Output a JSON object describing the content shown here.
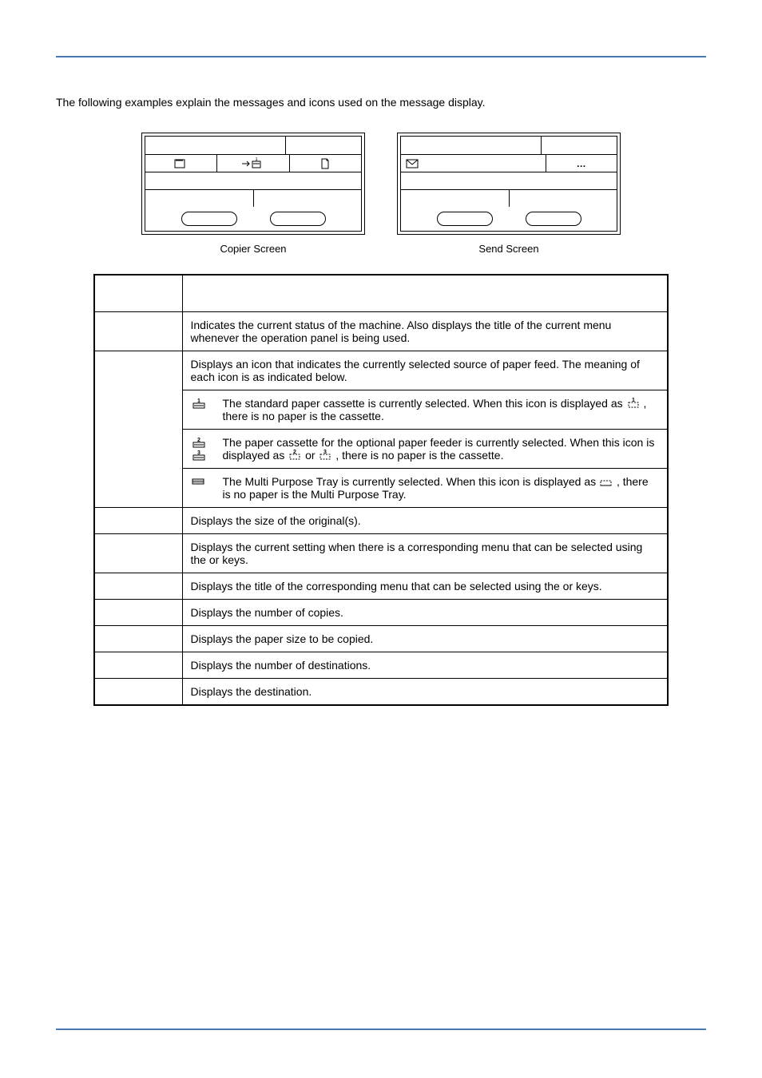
{
  "intro": "The following examples explain the messages and icons used on the message display.",
  "screens": {
    "left_caption": "Copier Screen",
    "right_caption": "Send Screen"
  },
  "table": {
    "header_left": "",
    "header_right": "",
    "rows": [
      {
        "ref": "",
        "desc": "Indicates the current status of the machine. Also displays the title of the current menu whenever the operation panel is being used."
      },
      {
        "ref": "",
        "desc": "Displays an icon that indicates the currently selected source of paper feed. The meaning of each icon is as indicated below."
      }
    ],
    "icon_rows": [
      {
        "icons": [
          "cassette1"
        ],
        "desc_a": "The standard paper cassette is currently selected. When this icon is displayed as ",
        "desc_b": ", there is no paper is the cassette."
      },
      {
        "icons": [
          "cassette2",
          "cassette3"
        ],
        "desc_a": "The paper cassette for the optional paper feeder is currently selected. When this icon is displayed as ",
        "desc_mid": " or ",
        "desc_b": ", there is no paper is the cassette."
      },
      {
        "icons": [
          "mptray"
        ],
        "desc_a": "The Multi Purpose Tray is currently selected. When this icon is displayed as ",
        "desc_b": ", there is no paper is the Multi Purpose Tray."
      }
    ],
    "simple_rows": [
      {
        "ref": "",
        "desc": "Displays the size of the original(s)."
      },
      {
        "ref": "",
        "desc_a": "Displays the current setting when there is a corresponding menu that can be selected using the ",
        "desc_mid": " or ",
        "desc_b": " keys."
      },
      {
        "ref": "",
        "desc_a": "Displays the title of the corresponding menu that can be selected using the ",
        "desc_mid": " or ",
        "desc_b": " keys."
      },
      {
        "ref": "",
        "desc": "Displays the number of copies."
      },
      {
        "ref": "",
        "desc": "Displays the paper size to be copied."
      },
      {
        "ref": "",
        "desc": "Displays the number of destinations."
      },
      {
        "ref": "",
        "desc": "Displays the destination."
      }
    ]
  }
}
